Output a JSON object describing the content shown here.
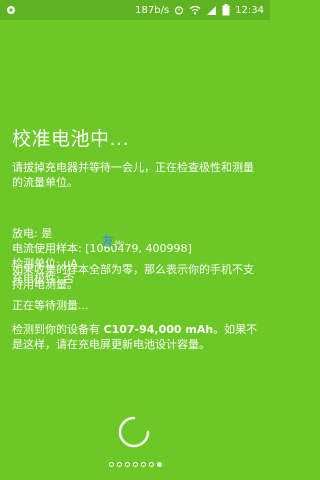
{
  "status_bar": {
    "net_speed": "187b/s",
    "time": "12:34"
  },
  "screen": {
    "title": "校准电池中...",
    "instruction": "请拔掉充电器并等待一会儿，正在检查极性和测量的流量单位。",
    "info": {
      "discharging": "放电: 是",
      "current_sample": "电流使用样本: [1060479, 400998]",
      "unit": "检测单位: μA",
      "charge_polarity": "充电极性: 否"
    },
    "zero_sample_note": "如果收集的样本全部为零，那么表示你的手机不支持用电测量。",
    "waiting": "正在等待测量...",
    "detected_prefix": "检测到你的设备有 ",
    "detected_value": "C107-94,000 mAh",
    "detected_suffix": "。如果不是这样，请在充电屏更新电池设计容量。"
  },
  "watermark": {
    "text": "友",
    "sub": "Mo"
  },
  "pager": {
    "count": 7,
    "active_index": 6
  },
  "colors": {
    "background": "#6cc827",
    "status_bar": "#5fb321",
    "text": "#ffffff"
  },
  "icons": [
    "notification-icon",
    "alarm-icon",
    "wifi-icon",
    "signal-icon",
    "battery-icon"
  ]
}
